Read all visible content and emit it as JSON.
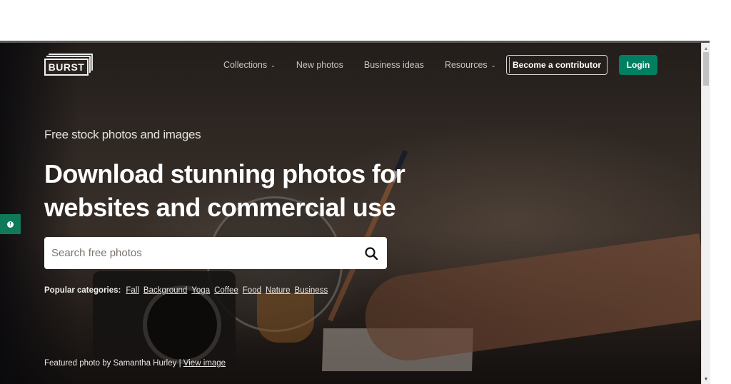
{
  "brand": {
    "logo_text": "BURST"
  },
  "nav": {
    "items": [
      {
        "label": "Collections",
        "has_dropdown": true
      },
      {
        "label": "New photos",
        "has_dropdown": false
      },
      {
        "label": "Business ideas",
        "has_dropdown": false
      },
      {
        "label": "Resources",
        "has_dropdown": true
      }
    ],
    "chevron_glyph": "⌄",
    "contributor_button": "Become a contributor",
    "login_button": "Login"
  },
  "hero": {
    "subtitle": "Free stock photos and images",
    "headline_line1": "Download stunning photos for",
    "headline_line2": "websites and commercial use",
    "search": {
      "placeholder": "Search free photos",
      "value": ""
    },
    "popular_label": "Popular categories:",
    "popular_categories": [
      "Fall",
      "Background",
      "Yoga",
      "Coffee",
      "Food",
      "Nature",
      "Business"
    ],
    "featured_text": "Featured photo by Samantha Hurley |",
    "featured_link": "View image"
  },
  "feedback_tab": {
    "icon": "info-icon",
    "glyph": "!"
  },
  "colors": {
    "accent": "#008060",
    "feedback_tab": "#0f7a5a",
    "hero_text": "#ffffff"
  },
  "scrollbar": {
    "up_glyph": "▲",
    "down_glyph": "▼"
  }
}
